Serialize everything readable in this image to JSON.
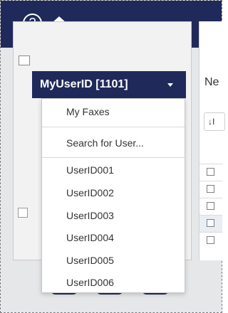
{
  "topbar": {
    "help_icon_glyph": "?",
    "icons": [
      "help-icon",
      "home-icon"
    ],
    "background": "#1f2a5a"
  },
  "user_dropdown": {
    "label": "MyUserID [1101]",
    "caret_icon": "caret-down-icon",
    "menu_items": [
      "My Faxes",
      "Search for User...",
      "UserID001",
      "UserID002",
      "UserID003",
      "UserID004",
      "UserID005",
      "UserID006"
    ]
  },
  "main": {
    "partial_label": "Ne",
    "sort_button_text": "↓I"
  }
}
